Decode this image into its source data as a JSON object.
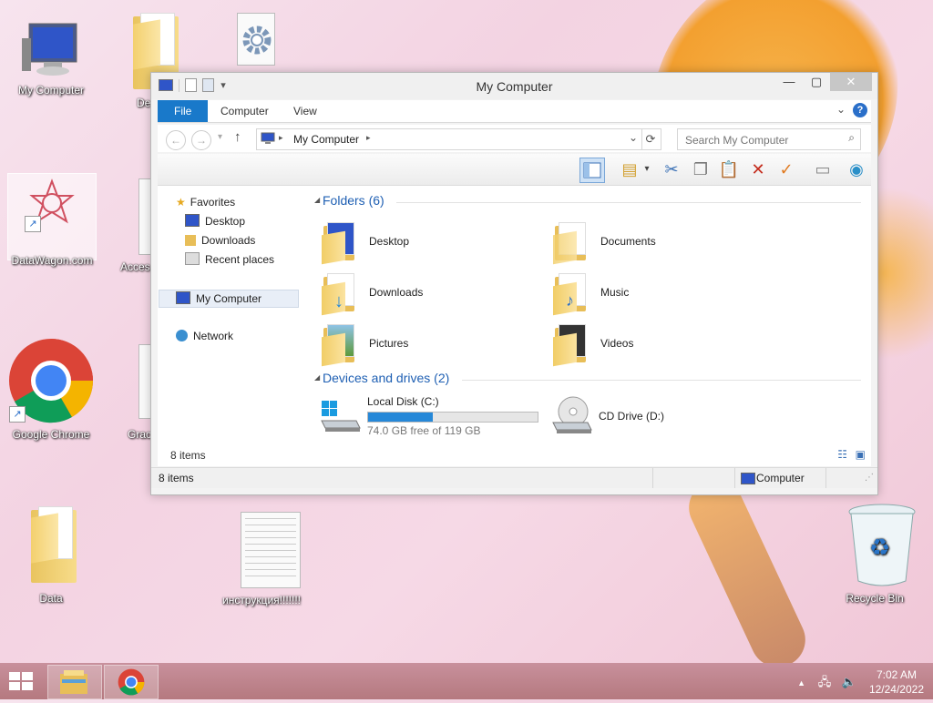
{
  "desktop": {
    "icons": [
      {
        "label": "My Computer"
      },
      {
        "label": "De"
      },
      {
        "label": "DataWagon.com"
      },
      {
        "label": "Acces"
      },
      {
        "label": "Google Chrome"
      },
      {
        "label": "Grac"
      },
      {
        "label": "Data"
      },
      {
        "label": "инструкция!!!!!!!"
      },
      {
        "label": "Recycle Bin"
      }
    ]
  },
  "window": {
    "title": "My Computer",
    "ribbon_tabs": [
      "File",
      "Computer",
      "View"
    ],
    "help": "?",
    "address": {
      "path": "My Computer"
    },
    "search": {
      "placeholder": "Search My Computer"
    },
    "nav": {
      "favorites": "Favorites",
      "desktop": "Desktop",
      "downloads": "Downloads",
      "recent": "Recent places",
      "my_computer": "My Computer",
      "network": "Network"
    },
    "folders_header": "Folders (6)",
    "folders": [
      {
        "label": "Desktop"
      },
      {
        "label": "Documents"
      },
      {
        "label": "Downloads"
      },
      {
        "label": "Music"
      },
      {
        "label": "Pictures"
      },
      {
        "label": "Videos"
      }
    ],
    "devices_header": "Devices and drives (2)",
    "drives": [
      {
        "label": "Local Disk (C:)",
        "free_text": "74.0 GB free of 119 GB",
        "used_fraction": 0.38
      },
      {
        "label": "CD Drive (D:)"
      }
    ],
    "items_count_inner": "8 items",
    "status": {
      "items": "8 items",
      "location": "Computer"
    }
  },
  "taskbar": {
    "time": "7:02 AM",
    "date": "12/24/2022"
  },
  "colors": {
    "accent": "#1979ca",
    "group_header": "#1e5fb3",
    "drive_fill": "#2688d8"
  }
}
